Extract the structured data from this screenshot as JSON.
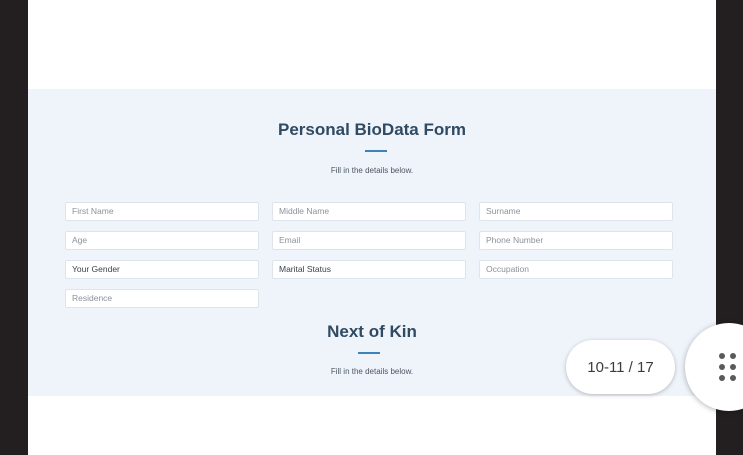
{
  "form": {
    "title": "Personal BioData Form",
    "subtitle": "Fill in the details below.",
    "fields": {
      "first_name": "First Name",
      "middle_name": "Middle Name",
      "surname": "Surname",
      "age": "Age",
      "email": "Email",
      "phone_number": "Phone Number",
      "gender": "Your Gender",
      "marital_status": "Marital Status",
      "occupation": "Occupation",
      "residence": "Residence"
    }
  },
  "next_of_kin": {
    "title": "Next of Kin",
    "subtitle": "Fill in the details below."
  },
  "viewer": {
    "page_indicator": "10-11 / 17",
    "menu_icon": "grid-dots-icon"
  }
}
